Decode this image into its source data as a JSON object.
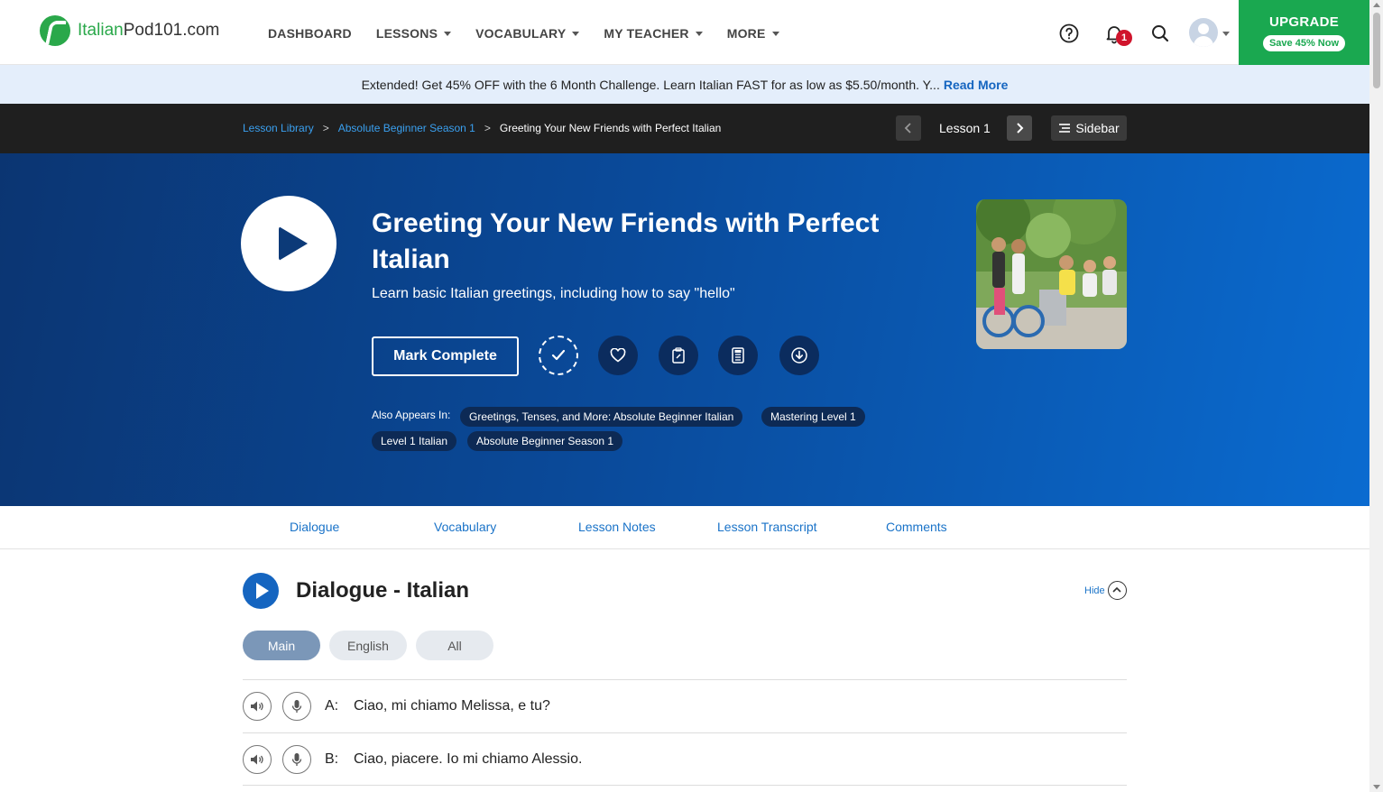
{
  "header": {
    "logo_text_prefix": "Italian",
    "logo_text_suffix": "Pod101.com",
    "menu": [
      {
        "label": "DASHBOARD"
      },
      {
        "label": "LESSONS"
      },
      {
        "label": "VOCABULARY"
      },
      {
        "label": "MY TEACHER"
      },
      {
        "label": "MORE"
      }
    ],
    "notification_count": "1",
    "upgrade_label": "UPGRADE",
    "upgrade_sub": "Save 45% Now"
  },
  "promo": {
    "text": "Extended! Get 45% OFF with the 6 Month Challenge. Learn Italian FAST for as low as $5.50/month. Y...",
    "link": "Read More"
  },
  "breadcrumb": {
    "items": [
      "Lesson Library",
      "Absolute Beginner Season 1"
    ],
    "current": "Greeting Your New Friends with Perfect Italian",
    "separator": ">",
    "lesson_label": "Lesson 1",
    "sidebar_label": "Sidebar"
  },
  "hero": {
    "title": "Greeting Your New Friends with Perfect Italian",
    "subtitle": "Learn basic Italian greetings, including how to say \"hello\"",
    "mark_complete": "Mark Complete",
    "also_appears_label": "Also Appears In:",
    "tags": [
      "Greetings, Tenses, and More: Absolute Beginner Italian",
      "Mastering Level 1",
      "Level 1 Italian",
      "Absolute Beginner Season 1"
    ]
  },
  "tabs": [
    "Dialogue",
    "Vocabulary",
    "Lesson Notes",
    "Lesson Transcript",
    "Comments"
  ],
  "dialogue": {
    "title": "Dialogue - Italian",
    "hide_label": "Hide",
    "filters": [
      "Main",
      "English",
      "All"
    ],
    "active_filter": "Main",
    "lines": [
      {
        "speaker": "A:",
        "text": "Ciao, mi chiamo Melissa, e tu?"
      },
      {
        "speaker": "B:",
        "text": "Ciao, piacere. Io mi chiamo Alessio."
      }
    ]
  },
  "colors": {
    "brand_green": "#1aa850",
    "link_blue": "#1a73c8",
    "hero_dark": "#0b3572",
    "hero_light": "#0a6bd0"
  }
}
